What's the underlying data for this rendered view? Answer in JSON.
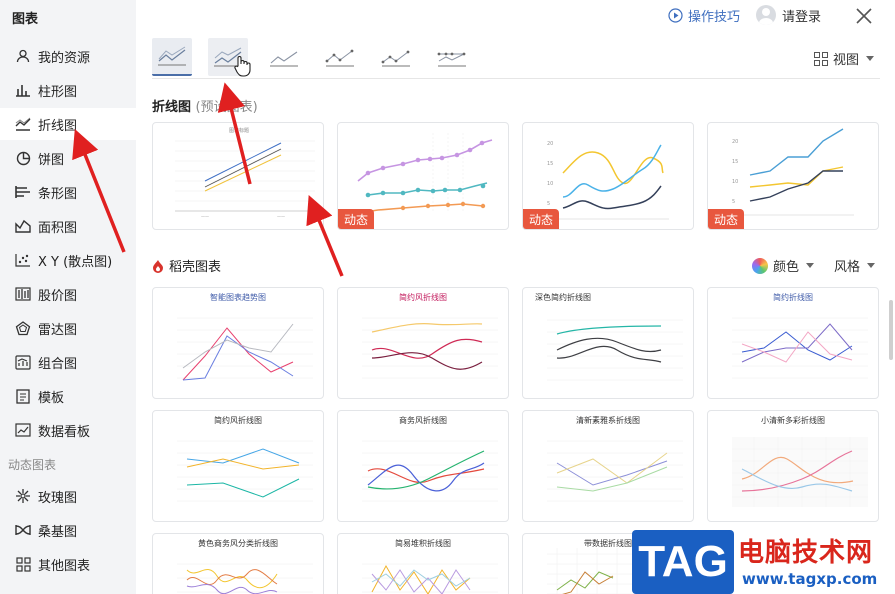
{
  "sidebar": {
    "title": "图表",
    "items": [
      {
        "label": "我的资源",
        "icon": "user-icon"
      },
      {
        "label": "柱形图",
        "icon": "column-chart-icon"
      },
      {
        "label": "折线图",
        "icon": "line-chart-icon"
      },
      {
        "label": "饼图",
        "icon": "pie-chart-icon"
      },
      {
        "label": "条形图",
        "icon": "bar-chart-icon"
      },
      {
        "label": "面积图",
        "icon": "area-chart-icon"
      },
      {
        "label": "X Y (散点图)",
        "icon": "scatter-chart-icon"
      },
      {
        "label": "股价图",
        "icon": "stock-chart-icon"
      },
      {
        "label": "雷达图",
        "icon": "radar-chart-icon"
      },
      {
        "label": "组合图",
        "icon": "combo-chart-icon"
      },
      {
        "label": "模板",
        "icon": "template-icon"
      },
      {
        "label": "数据看板",
        "icon": "dashboard-icon"
      }
    ],
    "section_label": "动态图表",
    "dynamic_items": [
      {
        "label": "玫瑰图",
        "icon": "rose-chart-icon"
      },
      {
        "label": "桑基图",
        "icon": "sankey-chart-icon"
      },
      {
        "label": "其他图表",
        "icon": "other-chart-icon"
      }
    ],
    "active_index": 2
  },
  "topbar": {
    "tips_label": "操作技巧",
    "login_label": "请登录"
  },
  "view_label": "视图",
  "preset": {
    "title": "折线图",
    "subtitle": "(预设图表)",
    "dynamic_badge": "动态"
  },
  "docer": {
    "title": "稻壳图表",
    "color_label": "颜色",
    "style_label": "风格"
  },
  "templates": [
    {
      "title": "智能图表趋势图"
    },
    {
      "title": "简约风折线图"
    },
    {
      "title": "深色简约折线图"
    },
    {
      "title": "简约折线图"
    },
    {
      "title": "简约风折线图"
    },
    {
      "title": "商务风折线图"
    },
    {
      "title": "清新素雅系折线图"
    },
    {
      "title": "小清新多彩折线图"
    },
    {
      "title": "黄色商务风分类折线图"
    },
    {
      "title": "简易堆积折线图"
    },
    {
      "title": "带数据折线图"
    }
  ],
  "watermark": {
    "tag": "TAG",
    "cn": "电脑技术网",
    "url": "www.tagxp.com"
  },
  "colors": {
    "accent": "#3f6fbf",
    "badge": "#e8573e",
    "sidebar_bg": "#f3f4f6",
    "arrow": "#e02020"
  }
}
